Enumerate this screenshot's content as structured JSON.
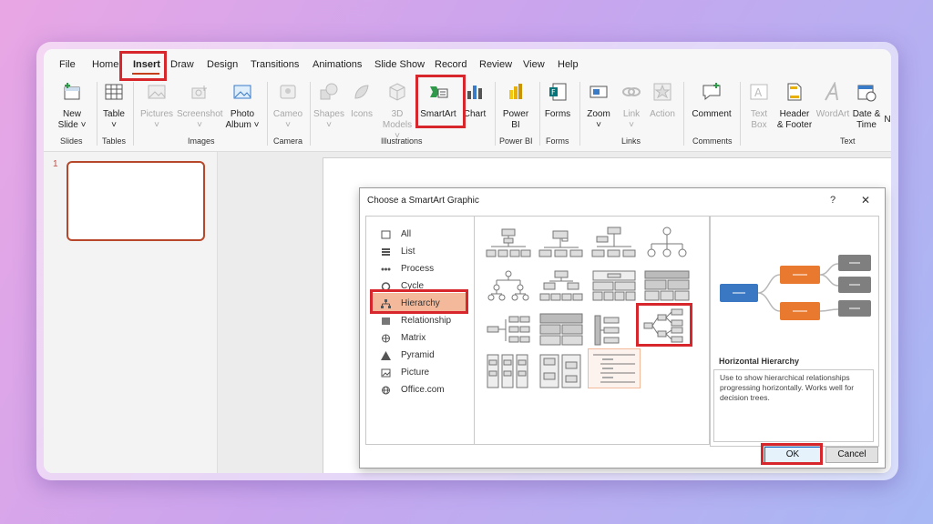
{
  "menu": [
    "File",
    "Home",
    "Insert",
    "Draw",
    "Design",
    "Transitions",
    "Animations",
    "Slide Show",
    "Record",
    "Review",
    "View",
    "Help"
  ],
  "ribbon": {
    "new_slide": [
      "New",
      "Slide ˅"
    ],
    "table": "Table",
    "pictures": "Pictures",
    "screenshot": "Screenshot",
    "photo_album": [
      "Photo",
      "Album ˅"
    ],
    "cameo": "Cameo",
    "shapes": "Shapes",
    "icons": "Icons",
    "models": [
      "3D",
      "Models ˅"
    ],
    "smartart": "SmartArt",
    "chart": "Chart",
    "power_bi": [
      "Power",
      "BI"
    ],
    "forms": "Forms",
    "zoom": "Zoom",
    "link": "Link",
    "action": "Action",
    "comment": "Comment",
    "text_box": [
      "Text",
      "Box"
    ],
    "header_footer": [
      "Header",
      "& Footer"
    ],
    "wordart": "WordArt",
    "date_time": [
      "Date &",
      "Time"
    ],
    "cut_n": "N",
    "groups": {
      "slides": "Slides",
      "tables": "Tables",
      "images": "Images",
      "camera": "Camera",
      "illustrations": "Illustrations",
      "power_bi": "Power BI",
      "forms": "Forms",
      "links": "Links",
      "comments": "Comments",
      "text": "Text"
    }
  },
  "slide_panel": {
    "number": "1"
  },
  "dialog": {
    "title": "Choose a SmartArt Graphic",
    "help": "?",
    "close": "✕",
    "categories": [
      "All",
      "List",
      "Process",
      "Cycle",
      "Hierarchy",
      "Relationship",
      "Matrix",
      "Pyramid",
      "Picture",
      "Office.com"
    ],
    "selected_category": "Hierarchy",
    "preview_title": "Horizontal Hierarchy",
    "preview_description": "Use to show hierarchical relationships progressing horizontally. Works well for decision trees.",
    "ok": "OK",
    "cancel": "Cancel"
  },
  "colors": {
    "accent_red": "#d7262c",
    "hierarchy_highlight": "#f3b99a",
    "blue_node": "#3b78c4",
    "orange_node": "#e8792e",
    "gray_node": "#7f7f7f"
  }
}
